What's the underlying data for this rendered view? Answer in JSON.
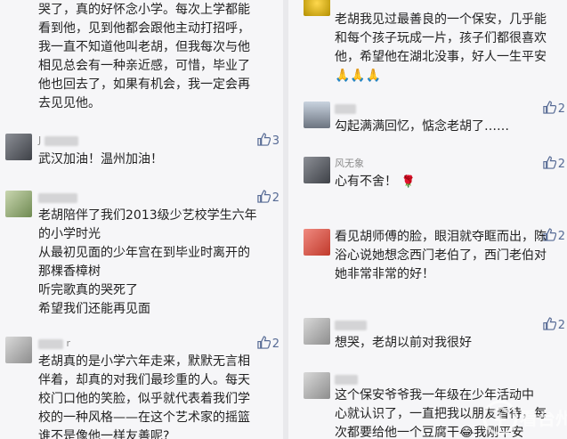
{
  "left": {
    "c0": {
      "lines": [
        "哭了，真的好怀念小学。每次上学都能",
        "看到他，见到他都会跟他主动打招呼，",
        "我一直不知道他叫老胡，但我每次与他",
        "相见总会有一种亲近感，可惜，毕业了",
        "他也回去了，如果有机会，我一定会再",
        "去见见他。"
      ]
    },
    "c1": {
      "name": "J",
      "likes": "3",
      "lines": [
        "武汉加油！温州加油！"
      ]
    },
    "c2": {
      "name": "",
      "likes": "2",
      "lines": [
        "老胡陪伴了我们2013级少艺校学生六年",
        "的小学时光",
        "从最初见面的少年宫在到毕业时离开的",
        "那棵香樟树",
        "听完歌真的哭死了",
        "希望我们还能再见面"
      ]
    },
    "c3": {
      "name": "r",
      "likes": "2",
      "lines": [
        "老胡真的是小学六年走来，默默无言相",
        "伴着，却真的对我们最珍重的人。每天",
        "校门口他的笑脸，似乎就代表着我们学",
        "校的一种风格——在这个艺术家的摇篮",
        "谁不是像他一样友善呢?"
      ]
    }
  },
  "right": {
    "c0": {
      "lines": [
        "老胡我见过最善良的一个保安，几乎能",
        "和每个孩子玩成一片，孩子们都很喜欢",
        "他，希望他在湖北没事，好人一生平安"
      ],
      "prays": "🙏🙏🙏"
    },
    "c1": {
      "name": "",
      "likes": "2",
      "lines": [
        "勾起满满回忆，惦念老胡了……"
      ]
    },
    "c2": {
      "name": "风无象",
      "likes": "2",
      "lines": [
        "心有不舍！"
      ],
      "flower": "🌹"
    },
    "c3": {
      "name": "",
      "likes": "2",
      "lines": [
        "看见胡师傅的脸，眼泪就夺眶而出，陈",
        "浴心说她想念西门老伯了，西门老伯对",
        "她非常非常的好！"
      ]
    },
    "c4": {
      "name": "",
      "likes": "2",
      "lines": [
        "想哭，老胡以前对我很好"
      ]
    },
    "c5": {
      "name": "",
      "lines": [
        "这个保安爷爷我一年级在少年活动中",
        "心就认识了，一直把我以朋友看待，每",
        "次都要给他一个豆腐干😂我刚平安"
      ]
    }
  },
  "icons": {
    "thumb": "thumb-up-icon",
    "accent": "#576b95"
  },
  "watermark": {
    "text": "看台州"
  }
}
